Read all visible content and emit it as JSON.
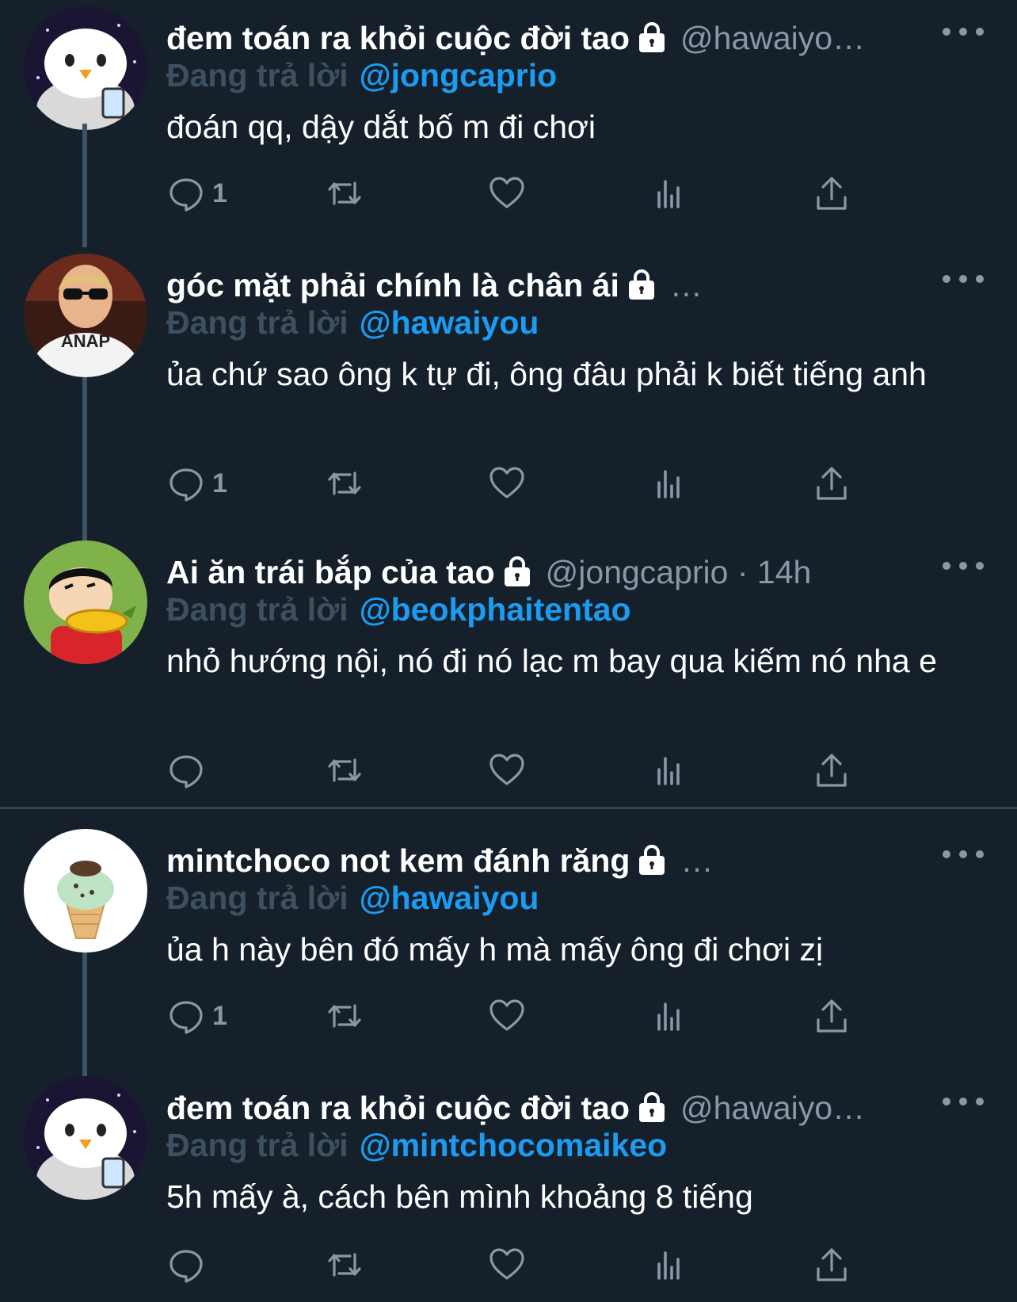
{
  "theme": {
    "background": "#15202b",
    "accent": "#1d9bf0",
    "muted": "#8899a6",
    "reply_label": "#3e5060"
  },
  "tweets": [
    {
      "name": "đem toán ra khỏi cuộc đời tao",
      "handle": "@hawaiyo…",
      "replying_label": "Đang trả lời",
      "replying_to": "@jongcaprio",
      "text": "đoán qq, dậy dắt bố m đi chơi",
      "reply_count": "1",
      "avatar": "penguin-avatar"
    },
    {
      "name": "góc mặt phải chính là chân ái",
      "handle": "…",
      "replying_label": "Đang trả lời",
      "replying_to": "@hawaiyou",
      "text": "ủa chứ sao ông k tự đi, ông đâu phải k biết tiếng anh",
      "reply_count": "1",
      "avatar": "kid-sunglasses-avatar"
    },
    {
      "name": "Ai ăn trái bắp của tao",
      "handle": "@jongcaprio · 14h",
      "replying_label": "Đang trả lời",
      "replying_to": "@beokphaitentao",
      "text": "nhỏ hướng nội, nó đi nó lạc m bay qua kiếm nó nha e",
      "reply_count": "",
      "avatar": "cartoon-corn-avatar"
    },
    {
      "name": "mintchoco not kem đánh răng",
      "handle": "…",
      "replying_label": "Đang trả lời",
      "replying_to": "@hawaiyou",
      "text": "ủa h này bên đó mấy h mà mấy ông đi chơi zị",
      "reply_count": "1",
      "avatar": "ice-cream-avatar"
    },
    {
      "name": "đem toán ra khỏi cuộc đời tao",
      "handle": "@hawaiyo…",
      "replying_label": "Đang trả lời",
      "replying_to": "@mintchocomaikeo",
      "text": "5h mấy à, cách bên mình khoảng 8 tiếng",
      "reply_count": "",
      "avatar": "penguin-avatar"
    }
  ]
}
